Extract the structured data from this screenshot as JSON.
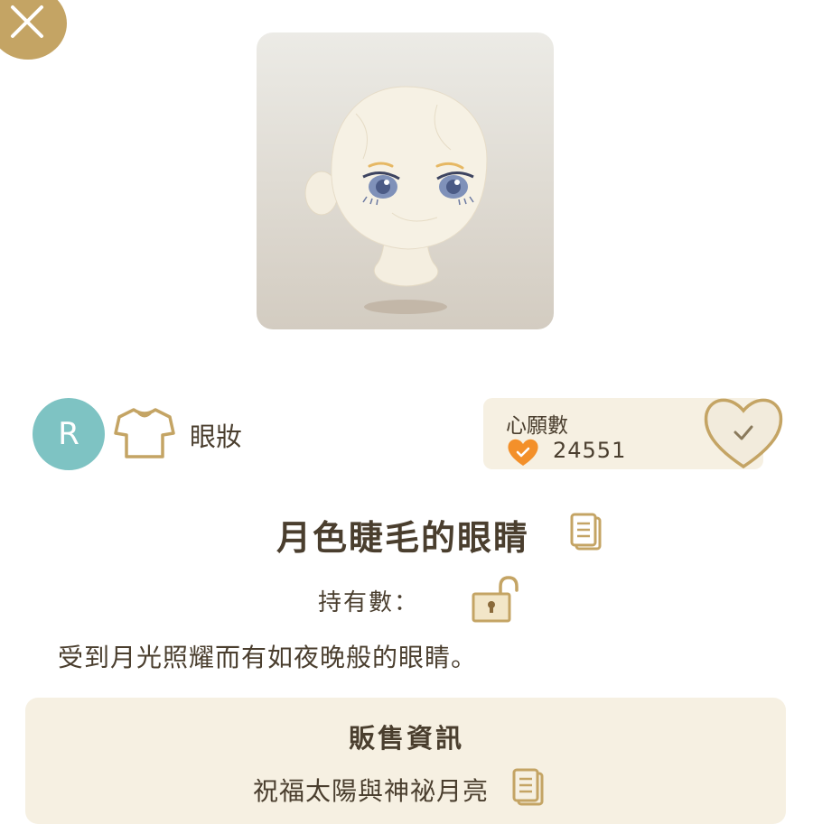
{
  "header": {
    "close_icon": "close-icon"
  },
  "item": {
    "rarity": "R",
    "category_icon": "shirt-icon",
    "category": "眼妝",
    "name": "月色睫毛的眼睛",
    "owned_label": "持有數：",
    "lock_icon": "unlocked-padlock-icon",
    "description": "受到月光照耀而有如夜晚般的眼睛。"
  },
  "wishlist": {
    "label": "心願數",
    "count": "24551",
    "button_icon": "heart-check-icon"
  },
  "sales": {
    "title": "販售資訊",
    "source": "祝福太陽與神祕月亮"
  },
  "colors": {
    "accent_gold": "#c4a464",
    "text_brown": "#4a3e2e",
    "panel_cream": "#f6f0e2",
    "rarity_teal": "#7ec3c3",
    "heart_orange": "#f3902a"
  }
}
